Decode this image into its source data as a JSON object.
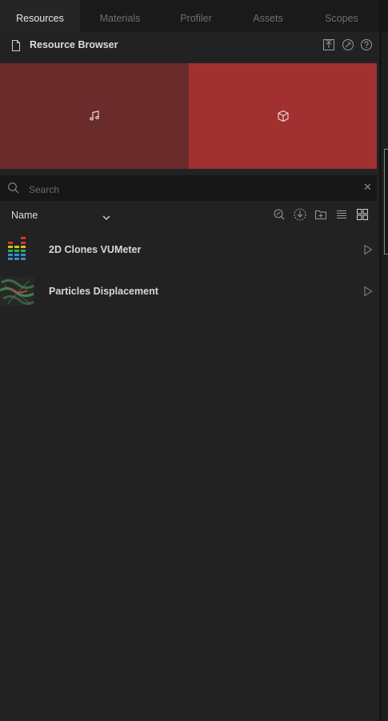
{
  "tabs": [
    {
      "label": "Resources",
      "active": true
    },
    {
      "label": "Materials",
      "active": false
    },
    {
      "label": "Profiler",
      "active": false
    },
    {
      "label": "Assets",
      "active": false
    },
    {
      "label": "Scopes",
      "active": false
    }
  ],
  "header": {
    "title": "Resource Browser",
    "icon": "document-icon",
    "actions": [
      "export-icon",
      "pin-icon",
      "help-icon"
    ]
  },
  "tiles": [
    {
      "name": "audio",
      "icon": "music-note-icon",
      "color": "#6b2b2b"
    },
    {
      "name": "3d-object",
      "icon": "cube-icon",
      "color": "#a13030"
    }
  ],
  "search": {
    "placeholder": "Search",
    "value": "",
    "clear_glyph": "✕"
  },
  "sort": {
    "label": "Name",
    "tools": [
      "zoom-search-icon",
      "download-icon",
      "new-folder-icon",
      "list-view-icon",
      "grid-view-icon"
    ]
  },
  "items": [
    {
      "label": "2D Clones VUMeter",
      "thumb": "vu-meter-thumbnail"
    },
    {
      "label": "Particles Displacement",
      "thumb": "particles-thumbnail"
    }
  ],
  "colors": {
    "background": "#222222",
    "tab_bar": "#1a1a1a",
    "accent_red": "#a13030",
    "dark_red": "#6b2b2b"
  }
}
